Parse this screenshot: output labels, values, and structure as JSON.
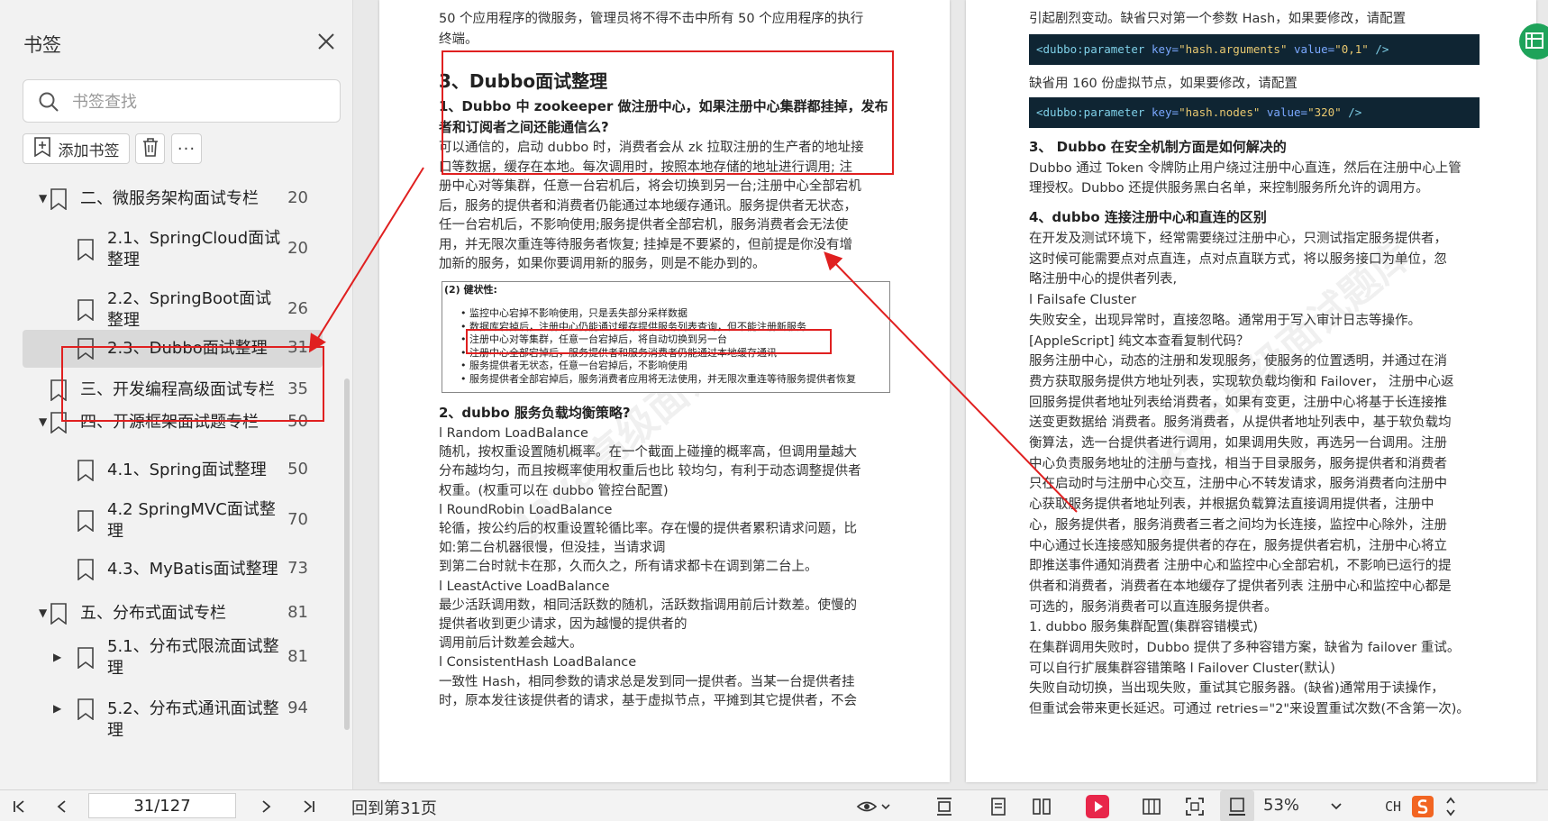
{
  "sidebar": {
    "title": "书签",
    "search_placeholder": "书签查找",
    "add_bookmark_label": "添加书签",
    "more_label": "···",
    "items": [
      {
        "label": "二、微服务架构面试专栏",
        "page": "20",
        "level": 1,
        "caret": "▼"
      },
      {
        "label": "2.1、SpringCloud面试整理",
        "page": "20",
        "level": 2,
        "caret": ""
      },
      {
        "label": "2.2、SpringBoot面试整理",
        "page": "26",
        "level": 2,
        "caret": ""
      },
      {
        "label": "2.3、Dubbo面试整理",
        "page": "31",
        "level": 2,
        "caret": "",
        "selected": true
      },
      {
        "label": "三、开发编程高级面试专栏",
        "page": "35",
        "level": 1,
        "caret": ""
      },
      {
        "label": "四、开源框架面试题专栏",
        "page": "50",
        "level": 1,
        "caret": "▼"
      },
      {
        "label": "4.1、Spring面试整理",
        "page": "50",
        "level": 2,
        "caret": ""
      },
      {
        "label": "4.2 SpringMVC面试整理",
        "page": "70",
        "level": 2,
        "caret": ""
      },
      {
        "label": "4.3、MyBatis面试整理",
        "page": "73",
        "level": 2,
        "caret": ""
      },
      {
        "label": "五、分布式面试专栏",
        "page": "81",
        "level": 1,
        "caret": "▼"
      },
      {
        "label": "5.1、分布式限流面试整理",
        "page": "81",
        "level": 2,
        "caret": "▶"
      },
      {
        "label": "5.2、分布式通讯面试整理",
        "page": "94",
        "level": 2,
        "caret": "▶"
      }
    ]
  },
  "left_page": {
    "intro1": "50 个应用程序的微服务，管理员将不得不击中所有 50 个应用程序的执行",
    "intro2": "终端。",
    "heading": "3、Dubbo面试整理",
    "q1_line1": "1、Dubbo 中 zookeeper 做注册中心，如果注册中心集群都挂掉，发布",
    "q1_line2": "者和订阅者之间还能通信么?",
    "a1": [
      "可以通信的，启动 dubbo 时，消费者会从 zk 拉取注册的生产者的地址接",
      "口等数据，缓存在本地。每次调用时，按照本地存储的地址进行调用; 注",
      "册中心对等集群，任意一台宕机后，将会切换到另一台;注册中心全部宕机",
      "后，服务的提供者和消费者仍能通过本地缓存通讯。服务提供者无状态，",
      "任一台宕机后，不影响使用;服务提供者全部宕机，服务消费者会无法使",
      "用，并无限次重连等待服务者恢复; 挂掉是不要紧的，但前提是你没有增",
      "加新的服务，如果你要调用新的服务，则是不能办到的。"
    ],
    "img_title": "(2) 健状性:",
    "img_lines": [
      "• 监控中心宕掉不影响使用，只是丢失部分采样数据",
      "• 数据库宕掉后，注册中心仍能通过缓存提供服务列表查询，但不能注册新服务",
      "• 注册中心对等集群，任意一台宕掉后，将自动切换到另一台",
      "• 注册中心全部宕掉后，服务提供者和服务消费者仍能通过本地缓存通讯",
      "• 服务提供者无状态，任意一台宕掉后，不影响使用",
      "• 服务提供者全部宕掉后，服务消费者应用将无法使用，并无限次重连等待服务提供者恢复"
    ],
    "q2": "2、dubbo 服务负载均衡策略?",
    "a2": [
      "l Random LoadBalance",
      "随机，按权重设置随机概率。在一个截面上碰撞的概率高，但调用量越大",
      "分布越均匀，而且按概率使用权重后也比 较均匀，有利于动态调整提供者",
      "权重。(权重可以在 dubbo 管控台配置)",
      "l RoundRobin LoadBalance",
      "轮循，按公约后的权重设置轮循比率。存在慢的提供者累积请求问题，比",
      "如:第二台机器很慢，但没挂，当请求调",
      "到第二台时就卡在那，久而久之，所有请求都卡在调到第二台上。",
      "l LeastActive LoadBalance",
      "最少活跃调用数，相同活跃数的随机，活跃数指调用前后计数差。使慢的",
      "提供者收到更少请求，因为越慢的提供者的",
      "调用前后计数差会越大。",
      "l ConsistentHash LoadBalance",
      "一致性 Hash，相同参数的请求总是发到同一提供者。当某一台提供者挂",
      "时，原本发往该提供者的请求，基于虚拟节点，平摊到其它提供者，不会"
    ]
  },
  "right_page": {
    "top_line": "引起剧烈变动。缺省只对第一个参数 Hash，如果要修改，请配置",
    "code1": {
      "tag": "<dubbo:parameter",
      "k1": "key=",
      "v1": "\"hash.arguments\"",
      "k2": "value=",
      "v2": "\"0,1\"",
      "end": "/>"
    },
    "mid_line": "缺省用 160 份虚拟节点，如果要修改，请配置",
    "code2": {
      "tag": "<dubbo:parameter",
      "k1": "key=",
      "v1": "\"hash.nodes\"",
      "k2": "value=",
      "v2": "\"320\"",
      "end": "/>"
    },
    "q3": "3、 Dubbo 在安全机制方面是如何解决的",
    "a3": [
      "Dubbo 通过 Token 令牌防止用户绕过注册中心直连，然后在注册中心上管",
      "理授权。Dubbo 还提供服务黑白名单，来控制服务所允许的调用方。"
    ],
    "q4": "4、dubbo 连接注册中心和直连的区别",
    "a4": [
      "在开发及测试环境下，经常需要绕过注册中心，只测试指定服务提供者，",
      "这时候可能需要点对点直连，点对点直联方式，将以服务接口为单位，忽",
      "略注册中心的提供者列表,",
      "l Failsafe Cluster",
      "失败安全，出现异常时，直接忽略。通常用于写入审计日志等操作。",
      "[AppleScript] 纯文本查看复制代码？",
      "服务注册中心，动态的注册和发现服务，使服务的位置透明，并通过在消",
      "费方获取服务提供方地址列表，实现软负载均衡和 Failover， 注册中心返",
      "回服务提供者地址列表给消费者，如果有变更，注册中心将基于长连接推",
      "送变更数据给 消费者。服务消费者，从提供者地址列表中，基于软负载均",
      "衡算法，选一台提供者进行调用，如果调用失败，再选另一台调用。注册",
      "中心负责服务地址的注册与查找，相当于目录服务，服务提供者和消费者",
      "只在启动时与注册中心交互，注册中心不转发请求，服务消费者向注册中",
      "心获取服务提供者地址列表，并根据负载算法直接调用提供者，注册中",
      "心，服务提供者，服务消费者三者之间均为长连接，监控中心除外，注册",
      "中心通过长连接感知服务提供者的存在，服务提供者宕机，注册中心将立",
      "即推送事件通知消费者 注册中心和监控中心全部宕机，不影响已运行的提",
      "供者和消费者，消费者在本地缓存了提供者列表 注册中心和监控中心都是",
      "可选的，服务消费者可以直连服务提供者。",
      "1. dubbo 服务集群配置(集群容错模式)",
      "在集群调用失败时，Dubbo 提供了多种容错方案，缺省为 failover 重试。",
      "可以自行扩展集群容错策略 l Failover Cluster(默认)",
      "失败自动切换，当出现失败，重试其它服务器。(缺省)通常用于读操作，",
      "但重试会带来更长延迟。可通过 retries=\"2\"来设置重试次数(不含第一次)。"
    ]
  },
  "bottombar": {
    "page_value": "31/127",
    "goto_label": "回到第31页",
    "zoom": "53%",
    "ime_label": "CH"
  },
  "colors": {
    "accent_red": "#e02020",
    "selected_bg": "#d9d9d9",
    "code_bg": "#0f2533",
    "fab_green": "#1ea35a",
    "record_red": "#e8264a"
  }
}
